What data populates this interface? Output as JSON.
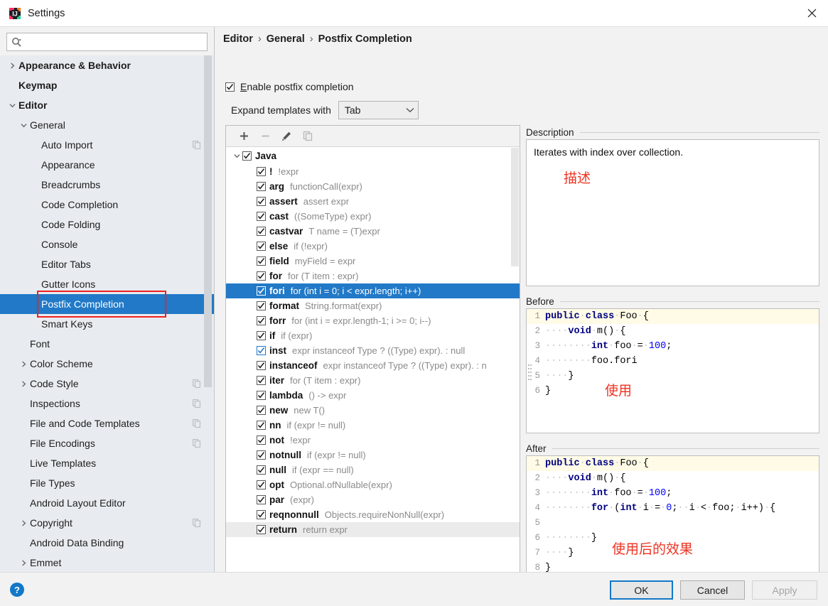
{
  "window": {
    "title": "Settings",
    "app_icon": "intellij-idea-icon",
    "close_icon": "close-icon"
  },
  "sidebar": {
    "search": {
      "placeholder": "",
      "value": "",
      "icon": "search-icon"
    },
    "items": [
      {
        "label": "Appearance & Behavior",
        "indent": 0,
        "arrow": "right",
        "bold": true,
        "copy": false,
        "selected": false
      },
      {
        "label": "Keymap",
        "indent": 0,
        "arrow": "none",
        "bold": true,
        "copy": false,
        "selected": false
      },
      {
        "label": "Editor",
        "indent": 0,
        "arrow": "down",
        "bold": true,
        "copy": false,
        "selected": false
      },
      {
        "label": "General",
        "indent": 1,
        "arrow": "down",
        "bold": false,
        "copy": false,
        "selected": false
      },
      {
        "label": "Auto Import",
        "indent": 2,
        "arrow": "none",
        "bold": false,
        "copy": true,
        "selected": false
      },
      {
        "label": "Appearance",
        "indent": 2,
        "arrow": "none",
        "bold": false,
        "copy": false,
        "selected": false
      },
      {
        "label": "Breadcrumbs",
        "indent": 2,
        "arrow": "none",
        "bold": false,
        "copy": false,
        "selected": false
      },
      {
        "label": "Code Completion",
        "indent": 2,
        "arrow": "none",
        "bold": false,
        "copy": false,
        "selected": false
      },
      {
        "label": "Code Folding",
        "indent": 2,
        "arrow": "none",
        "bold": false,
        "copy": false,
        "selected": false
      },
      {
        "label": "Console",
        "indent": 2,
        "arrow": "none",
        "bold": false,
        "copy": false,
        "selected": false
      },
      {
        "label": "Editor Tabs",
        "indent": 2,
        "arrow": "none",
        "bold": false,
        "copy": false,
        "selected": false
      },
      {
        "label": "Gutter Icons",
        "indent": 2,
        "arrow": "none",
        "bold": false,
        "copy": false,
        "selected": false
      },
      {
        "label": "Postfix Completion",
        "indent": 2,
        "arrow": "none",
        "bold": false,
        "copy": false,
        "selected": true
      },
      {
        "label": "Smart Keys",
        "indent": 2,
        "arrow": "none",
        "bold": false,
        "copy": false,
        "selected": false
      },
      {
        "label": "Font",
        "indent": 1,
        "arrow": "none",
        "bold": false,
        "copy": false,
        "selected": false
      },
      {
        "label": "Color Scheme",
        "indent": 1,
        "arrow": "right",
        "bold": false,
        "copy": false,
        "selected": false
      },
      {
        "label": "Code Style",
        "indent": 1,
        "arrow": "right",
        "bold": false,
        "copy": true,
        "selected": false
      },
      {
        "label": "Inspections",
        "indent": 1,
        "arrow": "none",
        "bold": false,
        "copy": true,
        "selected": false
      },
      {
        "label": "File and Code Templates",
        "indent": 1,
        "arrow": "none",
        "bold": false,
        "copy": true,
        "selected": false
      },
      {
        "label": "File Encodings",
        "indent": 1,
        "arrow": "none",
        "bold": false,
        "copy": true,
        "selected": false
      },
      {
        "label": "Live Templates",
        "indent": 1,
        "arrow": "none",
        "bold": false,
        "copy": false,
        "selected": false
      },
      {
        "label": "File Types",
        "indent": 1,
        "arrow": "none",
        "bold": false,
        "copy": false,
        "selected": false
      },
      {
        "label": "Android Layout Editor",
        "indent": 1,
        "arrow": "none",
        "bold": false,
        "copy": false,
        "selected": false
      },
      {
        "label": "Copyright",
        "indent": 1,
        "arrow": "right",
        "bold": false,
        "copy": true,
        "selected": false
      },
      {
        "label": "Android Data Binding",
        "indent": 1,
        "arrow": "none",
        "bold": false,
        "copy": false,
        "selected": false
      },
      {
        "label": "Emmet",
        "indent": 1,
        "arrow": "right",
        "bold": false,
        "copy": false,
        "selected": false
      }
    ],
    "highlight_annotation": {
      "target": "Postfix Completion",
      "color": "#ee2222"
    }
  },
  "main": {
    "breadcrumb": {
      "parts": [
        "Editor",
        "General",
        "Postfix Completion"
      ],
      "separator": "›"
    },
    "enable_checkbox": {
      "label": "Enable postfix completion",
      "mnemonic": "E",
      "checked": true
    },
    "expand_with": {
      "label": "Expand templates with",
      "value": "Tab",
      "chevron": "chevron-down-icon"
    },
    "toolbar": [
      {
        "name": "add-template-button",
        "icon": "plus-icon",
        "enabled": true
      },
      {
        "name": "remove-template-button",
        "icon": "minus-icon",
        "enabled": false
      },
      {
        "name": "edit-template-button",
        "icon": "pencil-icon",
        "enabled": true
      },
      {
        "name": "duplicate-template-button",
        "icon": "copy-icon",
        "enabled": false
      }
    ],
    "group": {
      "label": "Java",
      "checked": true,
      "expanded": true
    },
    "templates": [
      {
        "name": "!",
        "desc": "!expr",
        "checked": true,
        "state": "normal",
        "selected": false
      },
      {
        "name": "arg",
        "desc": "functionCall(expr)",
        "checked": true,
        "state": "normal",
        "selected": false
      },
      {
        "name": "assert",
        "desc": "assert expr",
        "checked": true,
        "state": "normal",
        "selected": false
      },
      {
        "name": "cast",
        "desc": "((SomeType) expr)",
        "checked": true,
        "state": "normal",
        "selected": false
      },
      {
        "name": "castvar",
        "desc": "T name = (T)expr",
        "checked": true,
        "state": "normal",
        "selected": false
      },
      {
        "name": "else",
        "desc": "if (!expr)",
        "checked": true,
        "state": "normal",
        "selected": false
      },
      {
        "name": "field",
        "desc": "myField = expr",
        "checked": true,
        "state": "normal",
        "selected": false
      },
      {
        "name": "for",
        "desc": "for (T item : expr)",
        "checked": true,
        "state": "normal",
        "selected": false
      },
      {
        "name": "fori",
        "desc": "for (int i = 0; i < expr.length; i++)",
        "checked": true,
        "state": "normal",
        "selected": true
      },
      {
        "name": "format",
        "desc": "String.format(expr)",
        "checked": true,
        "state": "normal",
        "selected": false
      },
      {
        "name": "forr",
        "desc": "for (int i = expr.length-1; i >= 0; i--)",
        "checked": true,
        "state": "normal",
        "selected": false
      },
      {
        "name": "if",
        "desc": "if (expr)",
        "checked": true,
        "state": "normal",
        "selected": false
      },
      {
        "name": "inst",
        "desc": "expr instanceof Type ? ((Type) expr). : null",
        "checked": true,
        "state": "focused",
        "selected": false
      },
      {
        "name": "instanceof",
        "desc": "expr instanceof Type ? ((Type) expr). : n",
        "checked": true,
        "state": "normal",
        "selected": false
      },
      {
        "name": "iter",
        "desc": "for (T item : expr)",
        "checked": true,
        "state": "normal",
        "selected": false
      },
      {
        "name": "lambda",
        "desc": "() -> expr",
        "checked": true,
        "state": "normal",
        "selected": false
      },
      {
        "name": "new",
        "desc": "new T()",
        "checked": true,
        "state": "normal",
        "selected": false
      },
      {
        "name": "nn",
        "desc": "if (expr != null)",
        "checked": true,
        "state": "normal",
        "selected": false
      },
      {
        "name": "not",
        "desc": "!expr",
        "checked": true,
        "state": "normal",
        "selected": false
      },
      {
        "name": "notnull",
        "desc": "if (expr != null)",
        "checked": true,
        "state": "normal",
        "selected": false
      },
      {
        "name": "null",
        "desc": "if (expr == null)",
        "checked": true,
        "state": "normal",
        "selected": false
      },
      {
        "name": "opt",
        "desc": "Optional.ofNullable(expr)",
        "checked": true,
        "state": "normal",
        "selected": false
      },
      {
        "name": "par",
        "desc": "(expr)",
        "checked": true,
        "state": "normal",
        "selected": false
      },
      {
        "name": "reqnonnull",
        "desc": "Objects.requireNonNull(expr)",
        "checked": true,
        "state": "normal",
        "selected": false
      },
      {
        "name": "return",
        "desc": "return expr",
        "checked": true,
        "state": "hover",
        "selected": false
      }
    ]
  },
  "right": {
    "description": {
      "title": "Description",
      "text": "Iterates with index over collection.",
      "annotation": "描述"
    },
    "before": {
      "title": "Before",
      "annotation": "使用",
      "lines": [
        {
          "n": "1",
          "tokens": [
            {
              "t": "public",
              "c": "kw"
            },
            {
              "t": " ",
              "c": "ws"
            },
            {
              "t": "class",
              "c": "kw"
            },
            {
              "t": " ",
              "c": "ws"
            },
            {
              "t": "Foo",
              "c": "plain"
            },
            {
              "t": " ",
              "c": "ws"
            },
            {
              "t": "{",
              "c": "plain"
            }
          ]
        },
        {
          "n": "2",
          "tokens": [
            {
              "t": "    ",
              "c": "ws"
            },
            {
              "t": "void",
              "c": "kw"
            },
            {
              "t": " ",
              "c": "ws"
            },
            {
              "t": "m()",
              "c": "plain"
            },
            {
              "t": " ",
              "c": "ws"
            },
            {
              "t": "{",
              "c": "plain"
            }
          ]
        },
        {
          "n": "3",
          "tokens": [
            {
              "t": "        ",
              "c": "ws"
            },
            {
              "t": "int",
              "c": "kw"
            },
            {
              "t": " ",
              "c": "ws"
            },
            {
              "t": "foo",
              "c": "plain"
            },
            {
              "t": " ",
              "c": "ws"
            },
            {
              "t": "=",
              "c": "plain"
            },
            {
              "t": " ",
              "c": "ws"
            },
            {
              "t": "100",
              "c": "num"
            },
            {
              "t": ";",
              "c": "plain"
            }
          ]
        },
        {
          "n": "4",
          "tokens": [
            {
              "t": "        ",
              "c": "ws"
            },
            {
              "t": "foo.fori",
              "c": "plain"
            }
          ]
        },
        {
          "n": "5",
          "tokens": [
            {
              "t": "    ",
              "c": "ws"
            },
            {
              "t": "}",
              "c": "plain"
            }
          ]
        },
        {
          "n": "6",
          "tokens": [
            {
              "t": "}",
              "c": "plain"
            }
          ]
        }
      ]
    },
    "after": {
      "title": "After",
      "annotation": "使用后的效果",
      "lines": [
        {
          "n": "1",
          "tokens": [
            {
              "t": "public",
              "c": "kw"
            },
            {
              "t": " ",
              "c": "ws"
            },
            {
              "t": "class",
              "c": "kw"
            },
            {
              "t": " ",
              "c": "ws"
            },
            {
              "t": "Foo",
              "c": "plain"
            },
            {
              "t": " ",
              "c": "ws"
            },
            {
              "t": "{",
              "c": "plain"
            }
          ]
        },
        {
          "n": "2",
          "tokens": [
            {
              "t": "    ",
              "c": "ws"
            },
            {
              "t": "void",
              "c": "kw"
            },
            {
              "t": " ",
              "c": "ws"
            },
            {
              "t": "m()",
              "c": "plain"
            },
            {
              "t": " ",
              "c": "ws"
            },
            {
              "t": "{",
              "c": "plain"
            }
          ]
        },
        {
          "n": "3",
          "tokens": [
            {
              "t": "        ",
              "c": "ws"
            },
            {
              "t": "int",
              "c": "kw"
            },
            {
              "t": " ",
              "c": "ws"
            },
            {
              "t": "foo",
              "c": "plain"
            },
            {
              "t": " ",
              "c": "ws"
            },
            {
              "t": "=",
              "c": "plain"
            },
            {
              "t": " ",
              "c": "ws"
            },
            {
              "t": "100",
              "c": "num"
            },
            {
              "t": ";",
              "c": "plain"
            }
          ]
        },
        {
          "n": "4",
          "tokens": [
            {
              "t": "        ",
              "c": "ws"
            },
            {
              "t": "for",
              "c": "kw"
            },
            {
              "t": " ",
              "c": "ws"
            },
            {
              "t": "(",
              "c": "plain"
            },
            {
              "t": "int",
              "c": "kw"
            },
            {
              "t": " ",
              "c": "ws"
            },
            {
              "t": "i",
              "c": "plain"
            },
            {
              "t": " ",
              "c": "ws"
            },
            {
              "t": "=",
              "c": "plain"
            },
            {
              "t": " ",
              "c": "ws"
            },
            {
              "t": "0",
              "c": "num"
            },
            {
              "t": ";",
              "c": "plain"
            },
            {
              "t": "  ",
              "c": "ws"
            },
            {
              "t": "i",
              "c": "plain"
            },
            {
              "t": " ",
              "c": "ws"
            },
            {
              "t": "<",
              "c": "plain"
            },
            {
              "t": " ",
              "c": "ws"
            },
            {
              "t": "foo;",
              "c": "plain"
            },
            {
              "t": " ",
              "c": "ws"
            },
            {
              "t": "i++)",
              "c": "plain"
            },
            {
              "t": " ",
              "c": "ws"
            },
            {
              "t": "{",
              "c": "plain"
            }
          ]
        },
        {
          "n": "5",
          "tokens": []
        },
        {
          "n": "6",
          "tokens": [
            {
              "t": "        ",
              "c": "ws"
            },
            {
              "t": "}",
              "c": "plain"
            }
          ]
        },
        {
          "n": "7",
          "tokens": [
            {
              "t": "    ",
              "c": "ws"
            },
            {
              "t": "}",
              "c": "plain"
            }
          ]
        },
        {
          "n": "8",
          "tokens": [
            {
              "t": "}",
              "c": "plain"
            }
          ]
        }
      ]
    }
  },
  "footer": {
    "help_icon": "question-mark-icon",
    "ok_label": "OK",
    "cancel_label": "Cancel",
    "apply_label": "Apply",
    "apply_enabled": false
  },
  "colors": {
    "selection_blue": "#2179c7",
    "annotation_red": "#ee3322",
    "sidebar_bg": "#e8ecf0",
    "panel_bg": "#f2f2f2"
  }
}
